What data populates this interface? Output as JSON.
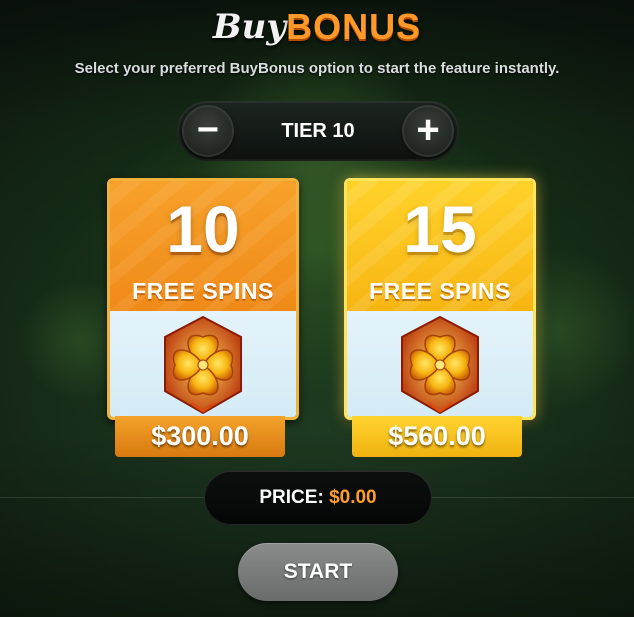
{
  "header": {
    "title_buy": "Buy",
    "title_bonus": "BONUS",
    "subtitle": "Select your preferred BuyBonus option to start the feature instantly."
  },
  "tier": {
    "minus_label": "−",
    "plus_label": "+",
    "label": "TIER 10"
  },
  "options": [
    {
      "spins": "10",
      "label": "FREE SPINS",
      "price": "$300.00",
      "icon": "golden-clover-icon",
      "color": "#f08a18"
    },
    {
      "spins": "15",
      "label": "FREE SPINS",
      "price": "$560.00",
      "icon": "golden-clover-icon",
      "color": "#f7b512"
    }
  ],
  "price": {
    "label": "PRICE:",
    "value": "$0.00"
  },
  "start": {
    "label": "START"
  },
  "colors": {
    "accent_orange": "#ff9a2a",
    "price_value": "#ff9f2a",
    "start_button": "#7a7c7b"
  }
}
